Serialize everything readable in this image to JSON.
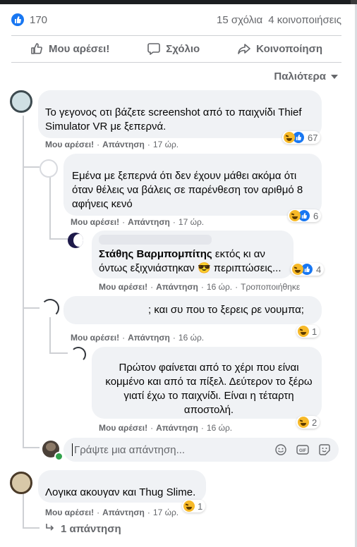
{
  "stats": {
    "likes": "170",
    "comments": "15 σχόλια",
    "shares": "4 κοινοποιήσεις"
  },
  "actions": {
    "like": "Μου αρέσει!",
    "comment": "Σχόλιο",
    "share": "Κοινοποίηση"
  },
  "sort": {
    "label": "Παλιότερα"
  },
  "comments": [
    {
      "text": "Το γεγονος οτι βάζετε screenshot από το παιχνίδι Thief Simulator VR με ξεπερνά.",
      "like": "Μου αρέσει!",
      "reply": "Απάντηση",
      "time": "17 ώρ.",
      "reactions": "67"
    },
    {
      "text": "Εμένα με ξεπερνά ότι δεν έχουν μάθει ακόμα ότι όταν θέλεις να βάλεις σε παρένθεση τον αριθμό 8 αφήνεις κενό",
      "like": "Μου αρέσει!",
      "reply": "Απάντηση",
      "time": "17 ώρ.",
      "reactions": "6"
    },
    {
      "mention": "Στάθης Βαρμπομπίτης",
      "text": "εκτός κι αν όντως εξιχνιάστηκαν 😎 περιπτώσεις...",
      "like": "Μου αρέσει!",
      "reply": "Απάντηση",
      "time": "16 ώρ.",
      "edited": "Τροποποιήθηκε",
      "reactions": "4"
    },
    {
      "text": "; και συ που το ξερεις ρε νουμπα;",
      "like": "Μου αρέσει!",
      "reply": "Απάντηση",
      "time": "16 ώρ.",
      "reactions": "1"
    },
    {
      "text": "Πρώτον φαίνεται από το χέρι που είναι κομμένο και από τα πίξελ. Δεύτερον το ξέρω γιατί έχω το παιχνίδι. Είναι η τέταρτη αποστολή.",
      "like": "Μου αρέσει!",
      "reply": "Απάντηση",
      "time": "16 ώρ.",
      "reactions": "2"
    },
    {
      "text": "Λογικα ακουγαν και Thug Slime.",
      "like": "Μου αρέσει!",
      "reply": "Απάντηση",
      "time": "17 ώρ.",
      "reactions": "1"
    }
  ],
  "reply_input": {
    "placeholder": "Γράψτε μια απάντηση..."
  },
  "more_replies": {
    "label": "1 απάντηση"
  }
}
